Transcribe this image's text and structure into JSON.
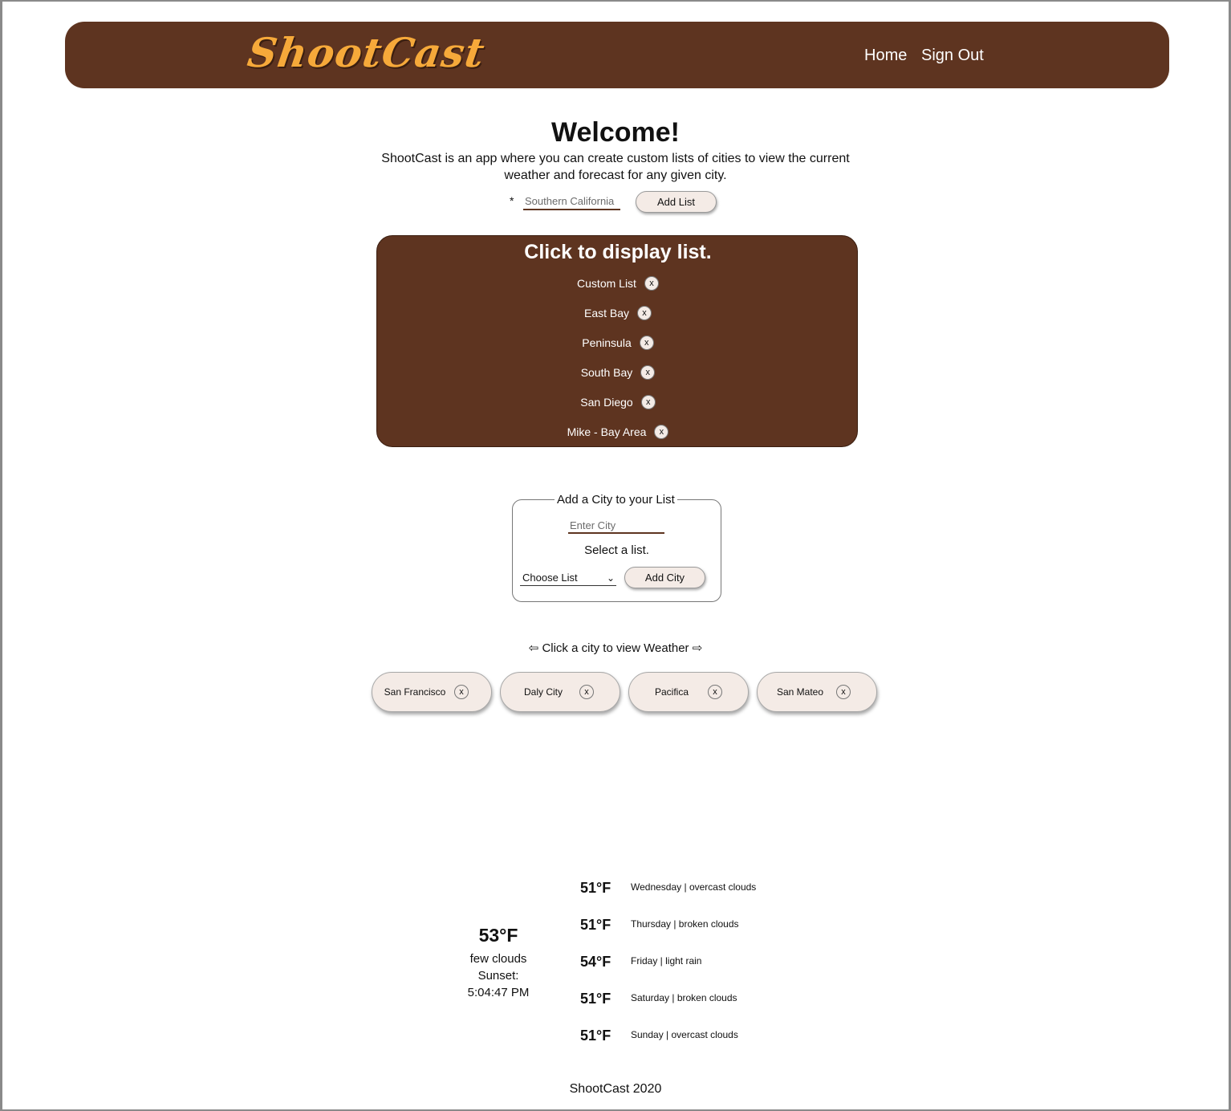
{
  "header": {
    "logo": "ShootCast",
    "nav": [
      "Home",
      "Sign Out"
    ],
    "colors": {
      "brand": "#5e3420",
      "logo": "#f6a93a"
    }
  },
  "welcome": {
    "title": "Welcome!",
    "description": "ShootCast is an app where you can create custom lists of cities to view the current weather and forecast for any given city."
  },
  "add_list": {
    "required_marker": "*",
    "placeholder": "Southern California",
    "button_label": "Add List"
  },
  "lists_panel": {
    "title": "Click to display list.",
    "remove_label": "x",
    "items": [
      {
        "label": "Custom List"
      },
      {
        "label": "East Bay"
      },
      {
        "label": "Peninsula"
      },
      {
        "label": "South Bay"
      },
      {
        "label": "San Diego"
      },
      {
        "label": "Mike - Bay Area"
      }
    ]
  },
  "add_city": {
    "legend": "Add a City to your List",
    "placeholder": "Enter City",
    "select_label": "Select a list.",
    "select_value": "Choose List",
    "button_label": "Add City"
  },
  "city_hint": "⇦ Click a city to view Weather ⇨",
  "cities": [
    {
      "label": "San Francisco"
    },
    {
      "label": "Daly City"
    },
    {
      "label": "Pacifica"
    },
    {
      "label": "San Mateo"
    }
  ],
  "current_weather": {
    "temp": "53°F",
    "condition": "few clouds",
    "sunset_label": "Sunset:",
    "sunset_time": "5:04:47 PM"
  },
  "forecast": [
    {
      "temp": "51°F",
      "desc": "Wednesday | overcast clouds"
    },
    {
      "temp": "51°F",
      "desc": "Thursday | broken clouds"
    },
    {
      "temp": "54°F",
      "desc": "Friday | light rain"
    },
    {
      "temp": "51°F",
      "desc": "Saturday | broken clouds"
    },
    {
      "temp": "51°F",
      "desc": "Sunday | overcast clouds"
    }
  ],
  "footer": "ShootCast 2020"
}
